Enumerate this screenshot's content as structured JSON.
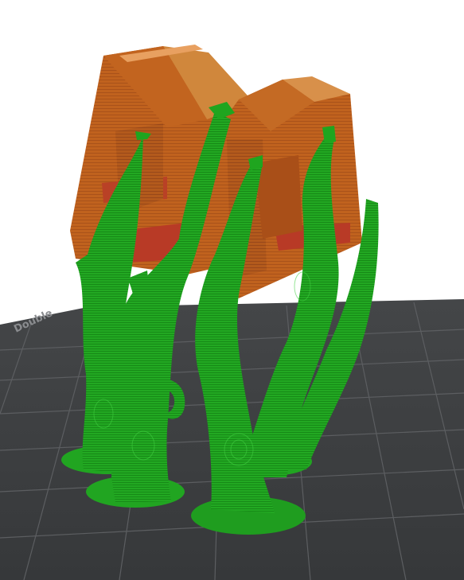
{
  "viewport": {
    "background_color": "#ffffff",
    "bed_color": "#3c3e40",
    "grid_color": "#5a5c5f",
    "model_color": "#c0621e",
    "model_highlight": "#d98a3a",
    "model_shadow_color": "#8e3f14",
    "internal_infill_color": "#b83a26",
    "support_color": "#1ea01e",
    "support_highlight": "#3ad23a",
    "bed_label": "Double"
  }
}
